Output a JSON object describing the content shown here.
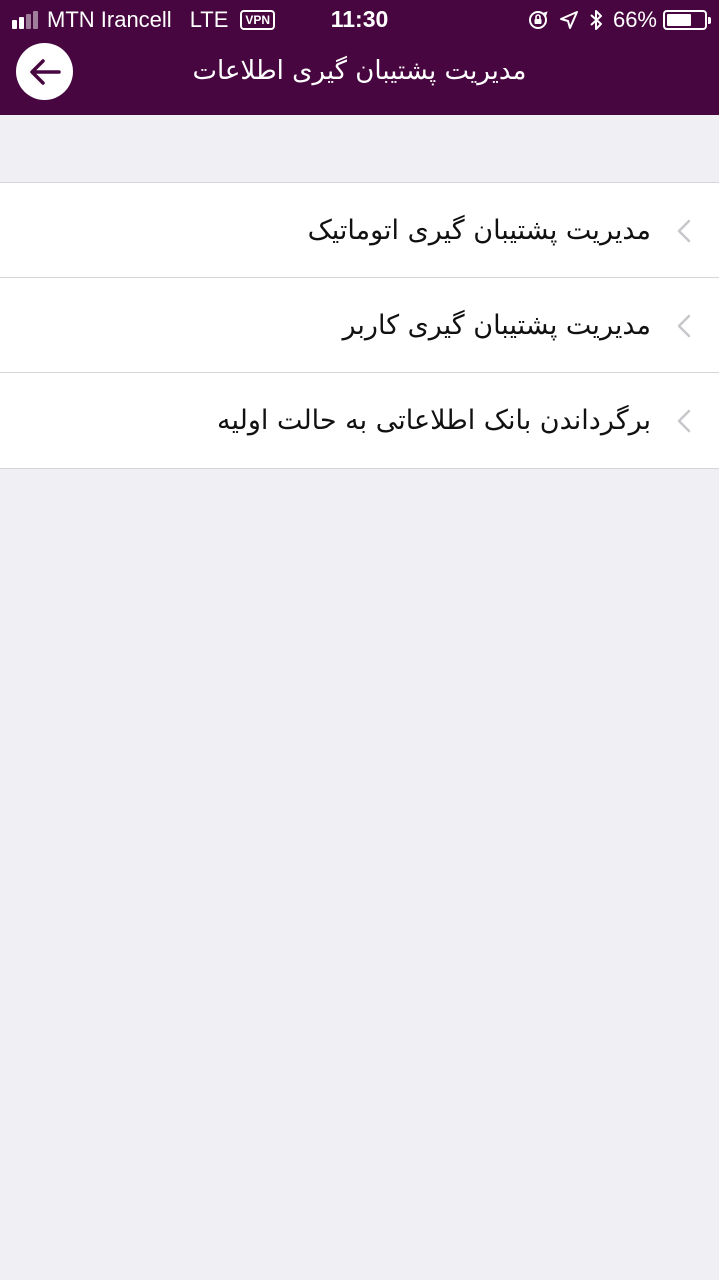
{
  "status_bar": {
    "carrier": "MTN Irancell",
    "network": "LTE",
    "vpn": "VPN",
    "time": "11:30",
    "battery_percent_text": "66%",
    "battery_level": 0.66,
    "signal_bars_filled": 2,
    "signal_bars_total": 4
  },
  "header": {
    "title": "مدیریت پشتیبان گیری اطلاعات",
    "background": "#480640"
  },
  "menu": {
    "items": [
      {
        "label": "مدیریت پشتیبان گیری اتوماتیک"
      },
      {
        "label": "مدیریت پشتیبان گیری کاربر"
      },
      {
        "label": "برگرداندن بانک اطلاعاتی به حالت اولیه"
      }
    ]
  }
}
